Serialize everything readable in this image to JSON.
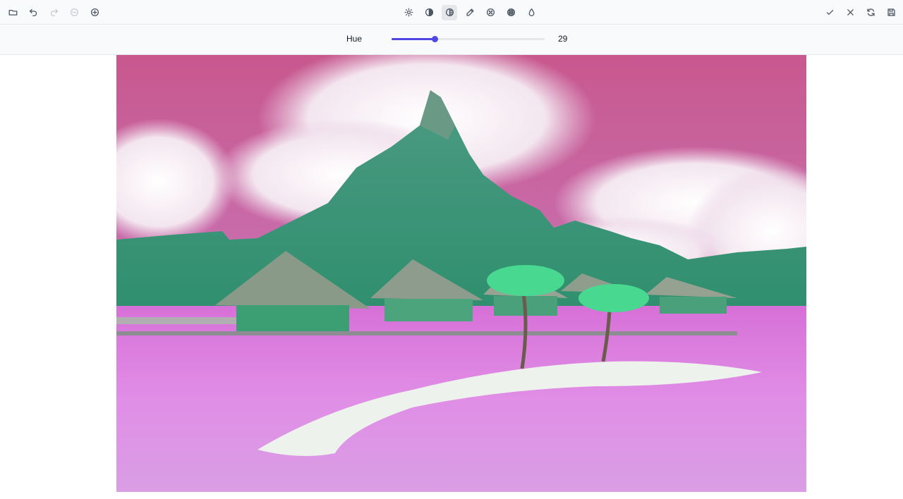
{
  "toolbar": {
    "left": [
      {
        "name": "open-folder-button",
        "icon": "folder-icon",
        "enabled": true
      },
      {
        "name": "undo-button",
        "icon": "undo-icon",
        "enabled": true
      },
      {
        "name": "redo-button",
        "icon": "redo-icon",
        "enabled": false
      },
      {
        "name": "zoom-out-button",
        "icon": "zoom-out-icon",
        "enabled": false
      },
      {
        "name": "zoom-in-button",
        "icon": "zoom-in-icon",
        "enabled": true
      }
    ],
    "center": [
      {
        "name": "brightness-tool-button",
        "icon": "sun-icon"
      },
      {
        "name": "contrast-tool-button",
        "icon": "contrast-icon"
      },
      {
        "name": "hue-tool-button",
        "icon": "hue-icon",
        "active": true
      },
      {
        "name": "color-picker-tool-button",
        "icon": "eyedropper-icon"
      },
      {
        "name": "blur-tool-button",
        "icon": "blur-dots-icon"
      },
      {
        "name": "pixelate-tool-button",
        "icon": "grid-circle-icon"
      },
      {
        "name": "saturation-tool-button",
        "icon": "droplet-icon"
      }
    ],
    "right": [
      {
        "name": "apply-button",
        "icon": "check-icon"
      },
      {
        "name": "cancel-button",
        "icon": "close-icon"
      },
      {
        "name": "reset-button",
        "icon": "refresh-icon"
      },
      {
        "name": "save-button",
        "icon": "save-icon"
      }
    ]
  },
  "adjustment": {
    "label": "Hue",
    "value": "29",
    "slider_fraction": 0.285,
    "accent": "#4f46e5"
  },
  "image": {
    "description_icon": "photo-canvas"
  }
}
